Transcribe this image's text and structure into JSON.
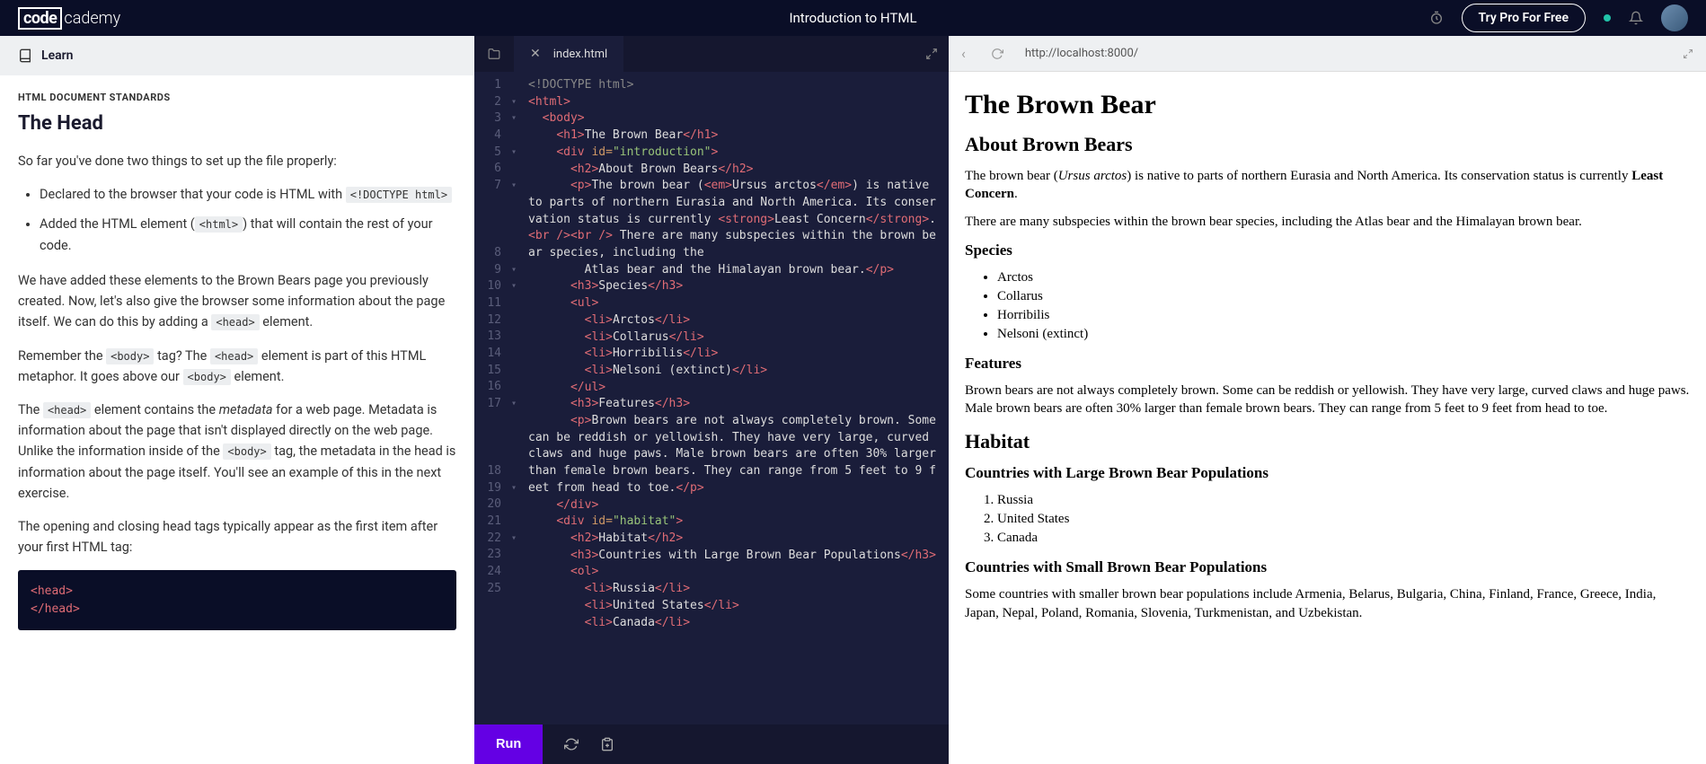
{
  "header": {
    "logo_box": "code",
    "logo_rest": "cademy",
    "title": "Introduction to HTML",
    "try_pro": "Try Pro For Free"
  },
  "learn_label": "Learn",
  "lesson": {
    "section": "HTML DOCUMENT STANDARDS",
    "title": "The Head",
    "p1": "So far you've done two things to set up the file properly:",
    "li1a": "Declared to the browser that your code is HTML with ",
    "li1b": "<!DOCTYPE html>",
    "li2a": "Added the HTML element (",
    "li2b": "<html>",
    "li2c": ") that will contain the rest of your code.",
    "p2a": "We have added these elements to the Brown Bears page you previously created. Now, let's also give the browser some information about the page itself. We can do this by adding a ",
    "p2b": "<head>",
    "p2c": " element.",
    "p3a": "Remember the ",
    "p3b": "<body>",
    "p3c": " tag? The ",
    "p3d": "<head>",
    "p3e": " element is part of this HTML metaphor. It goes above our ",
    "p3f": "<body>",
    "p3g": " element.",
    "p4a": "The ",
    "p4b": "<head>",
    "p4c": " element contains the ",
    "p4d": "metadata",
    "p4e": " for a web page. Metadata is information about the page that isn't displayed directly on the web page. Unlike the information inside of the ",
    "p4f": "<body>",
    "p4g": " tag, the metadata in the head is information about the page itself. You'll see an example of this in the next exercise.",
    "p5": "The opening and closing head tags typically appear as the first item after your first HTML tag:",
    "code1": "<head>",
    "code2": "</head>"
  },
  "editor": {
    "tab_name": "index.html",
    "run": "Run"
  },
  "code": {
    "l1": "<!DOCTYPE html>",
    "l2_pad": "",
    "l3_pad": " ",
    "introduction_id": "\"introduction\"",
    "habitat_id": "\"habitat\"",
    "h1_text": "The Brown Bear",
    "h2_about": "About Brown Bears",
    "p_intro_a": "The brown bear (",
    "p_intro_em": "Ursus arctos",
    "p_intro_b": ") is native to parts of northern Eurasia and North America. Its conservation status is currently ",
    "p_intro_strong": "Least Concern",
    "p_intro_c": ".",
    "p_intro_d": " There are many subspecies within the brown bear species, including the",
    "l8_text": "Atlas bear and the Himalayan brown bear.",
    "h3_species": "Species",
    "li_arctos": "Arctos",
    "li_collarus": "Collarus",
    "li_horribilis": "Horribilis",
    "li_nelsoni": "Nelsoni (extinct)",
    "h3_features": "Features",
    "p_features": "Brown bears are not always completely brown. Some can be reddish or yellowish. They have very large, curved claws and huge paws. Male brown bears are often 30% larger than female brown bears. They can range from 5 feet to 9 feet from head to toe.",
    "h2_habitat": "Habitat",
    "h3_large": "Countries with Large Brown Bear Populations",
    "li_russia": "Russia",
    "li_us": "United States",
    "li_canada": "Canada"
  },
  "browser": {
    "url": "http://localhost:8000/"
  },
  "preview": {
    "h1": "The Brown Bear",
    "h2_about": "About Brown Bears",
    "p1a": "The brown bear (",
    "p1em": "Ursus arctos",
    "p1b": ") is native to parts of northern Eurasia and North America. Its conservation status is currently ",
    "p1strong": "Least Concern",
    "p1c": ".",
    "p2": "There are many subspecies within the brown bear species, including the Atlas bear and the Himalayan brown bear.",
    "h3_species": "Species",
    "li_arctos": "Arctos",
    "li_collarus": "Collarus",
    "li_horribilis": "Horribilis",
    "li_nelsoni": "Nelsoni (extinct)",
    "h3_features": "Features",
    "p_features": "Brown bears are not always completely brown. Some can be reddish or yellowish. They have very large, curved claws and huge paws. Male brown bears are often 30% larger than female brown bears. They can range from 5 feet to 9 feet from head to toe.",
    "h2_habitat": "Habitat",
    "h3_large": "Countries with Large Brown Bear Populations",
    "li_russia": "Russia",
    "li_us": "United States",
    "li_canada": "Canada",
    "h3_small": "Countries with Small Brown Bear Populations",
    "p_small": "Some countries with smaller brown bear populations include Armenia, Belarus, Bulgaria, China, Finland, France, Greece, India, Japan, Nepal, Poland, Romania, Slovenia, Turkmenistan, and Uzbekistan."
  }
}
